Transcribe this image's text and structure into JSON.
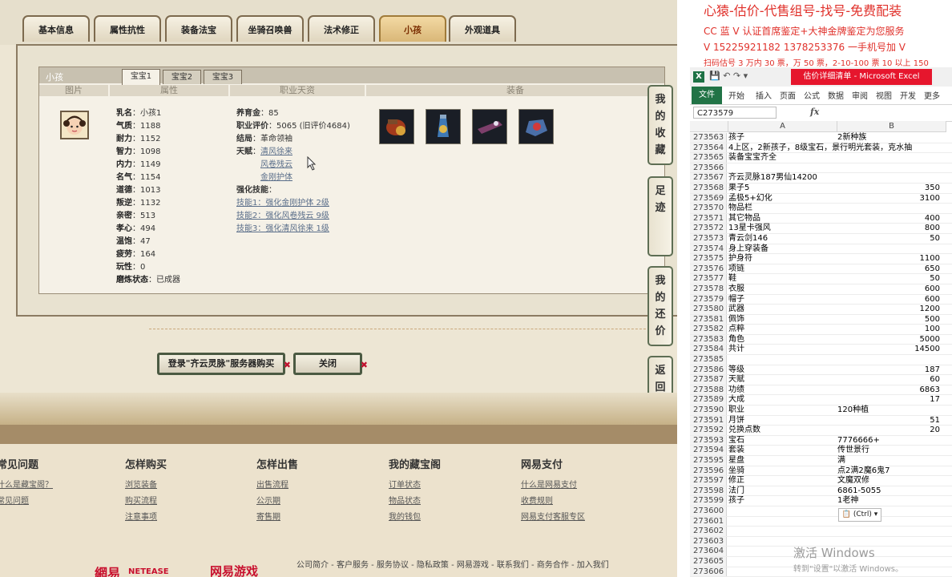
{
  "top_tabs": [
    {
      "label": "基本信息",
      "active": false
    },
    {
      "label": "属性抗性",
      "active": false
    },
    {
      "label": "装备法宝",
      "active": false
    },
    {
      "label": "坐骑召唤兽",
      "active": false
    },
    {
      "label": "法术修正",
      "active": false
    },
    {
      "label": "小孩",
      "active": true
    },
    {
      "label": "外观道具",
      "active": false
    }
  ],
  "child_panel": {
    "title": "小孩",
    "subtabs": [
      "宝宝1",
      "宝宝2",
      "宝宝3"
    ],
    "columns": [
      "图片",
      "属性",
      "职业天资",
      "装备"
    ],
    "attributes": [
      {
        "k": "乳名",
        "v": "小孩1"
      },
      {
        "k": "气质",
        "v": "1188"
      },
      {
        "k": "耐力",
        "v": "1152"
      },
      {
        "k": "智力",
        "v": "1098"
      },
      {
        "k": "内力",
        "v": "1149"
      },
      {
        "k": "名气",
        "v": "1154"
      },
      {
        "k": "道德",
        "v": "1013"
      },
      {
        "k": "叛逆",
        "v": "1132"
      },
      {
        "k": "亲密",
        "v": "513"
      },
      {
        "k": "孝心",
        "v": "494"
      },
      {
        "k": "温饱",
        "v": "47"
      },
      {
        "k": "疲劳",
        "v": "164"
      },
      {
        "k": "玩性",
        "v": "0"
      },
      {
        "k": "磨炼状态",
        "v": "已成器"
      }
    ],
    "yangyu": {
      "k": "养育金",
      "v": "85"
    },
    "zhiye": {
      "k": "职业评价",
      "v": "5065 (旧评价4684)"
    },
    "jieju": {
      "k": "结局",
      "v": "革命领袖"
    },
    "tianfu_label": "天赋",
    "tianfu": [
      "清风徐来",
      "风卷残云",
      "金刚护体"
    ],
    "skills_label": "强化技能",
    "skills": [
      "技能1：强化金刚护体 2级",
      "技能2：强化风卷残云 9级",
      "技能3：强化清风徐来 1级"
    ]
  },
  "buttons": {
    "login": "登录\"齐云灵脉\"服务器购买",
    "close": "关闭"
  },
  "side_buttons": [
    "我的收藏",
    "足迹",
    "我的还价",
    "返回顶部"
  ],
  "footer": {
    "columns": [
      {
        "title": "常见问题",
        "links": [
          "什么是藏宝阁？",
          "常见问题"
        ]
      },
      {
        "title": "怎样购买",
        "links": [
          "浏览装备",
          "购买流程",
          "注意事项"
        ]
      },
      {
        "title": "怎样出售",
        "links": [
          "出售流程",
          "公示期",
          "寄售期"
        ]
      },
      {
        "title": "我的藏宝阁",
        "links": [
          "订单状态",
          "物品状态",
          "我的钱包"
        ]
      },
      {
        "title": "网易支付",
        "links": [
          "什么是网易支付",
          "收费规则",
          "网易支付客服专区"
        ]
      }
    ],
    "bottom_links": "公司简介 - 客户服务 - 服务协议 - 隐私政策 - 网易游戏 - 联系我们 - 商务合作 - 加入我们",
    "logo_cn": "網易",
    "logo_en": "NETEASE",
    "logo_game": "网易游戏"
  },
  "ads": {
    "line1": "心猿-估价-代售组号-找号-免费配装",
    "line2": "CC 蓝 V 认证首席鉴定+大神金牌鉴定为您服务",
    "line3": "V 15225921182    1378253376 一手机号加 V",
    "line4": "扫码估号 3 万内 30 票，万 50 票，2-10-100 票 10 以上 150"
  },
  "excel": {
    "icon": "X",
    "caption": "估价详细清单 - Microsoft Excel",
    "ribbon": [
      "文件",
      "开始",
      "插入",
      "页面",
      "公式",
      "数据",
      "审阅",
      "视图",
      "开发",
      "更多"
    ],
    "namebox": "C273579",
    "fx": "fx",
    "col_a": "A",
    "col_b": "B",
    "rows": [
      {
        "n": "273563",
        "a": "孩子",
        "b": "2新种族",
        "num": false
      },
      {
        "n": "273564",
        "a": "4上区，2新孩子，8级宝石，景行明光套装，克水抽",
        "b": "",
        "num": false
      },
      {
        "n": "273565",
        "a": "装备宝宝齐全",
        "b": "",
        "num": false
      },
      {
        "n": "273566",
        "a": "",
        "b": "",
        "num": false
      },
      {
        "n": "273567",
        "a": "齐云灵脉187男仙14200",
        "b": "",
        "num": false
      },
      {
        "n": "273568",
        "a": "果子5",
        "b": "350",
        "num": true
      },
      {
        "n": "273569",
        "a": "孟极5+幻化",
        "b": "3100",
        "num": true
      },
      {
        "n": "273570",
        "a": "物品栏",
        "b": "",
        "num": false
      },
      {
        "n": "273571",
        "a": "其它物品",
        "b": "400",
        "num": true
      },
      {
        "n": "273572",
        "a": "13星卡强风",
        "b": "800",
        "num": true
      },
      {
        "n": "273573",
        "a": "青云剑146",
        "b": "50",
        "num": true
      },
      {
        "n": "273574",
        "a": "身上穿装备",
        "b": "",
        "num": false
      },
      {
        "n": "273575",
        "a": "护身符",
        "b": "1100",
        "num": true
      },
      {
        "n": "273576",
        "a": "项链",
        "b": "650",
        "num": true
      },
      {
        "n": "273577",
        "a": "鞋",
        "b": "50",
        "num": true
      },
      {
        "n": "273578",
        "a": "衣服",
        "b": "600",
        "num": true
      },
      {
        "n": "273579",
        "a": "帽子",
        "b": "600",
        "num": true
      },
      {
        "n": "273580",
        "a": "武器",
        "b": "1200",
        "num": true
      },
      {
        "n": "273581",
        "a": "佩饰",
        "b": "500",
        "num": true
      },
      {
        "n": "273582",
        "a": "点粹",
        "b": "100",
        "num": true
      },
      {
        "n": "273583",
        "a": "角色",
        "b": "5000",
        "num": true
      },
      {
        "n": "273584",
        "a": "共计",
        "b": "14500",
        "num": true
      },
      {
        "n": "273585",
        "a": "",
        "b": "",
        "num": false
      },
      {
        "n": "273586",
        "a": "等级",
        "b": "187",
        "num": true
      },
      {
        "n": "273587",
        "a": "天赋",
        "b": "60",
        "num": true
      },
      {
        "n": "273588",
        "a": "功绩",
        "b": "6863",
        "num": true
      },
      {
        "n": "273589",
        "a": "大成",
        "b": "17",
        "num": true
      },
      {
        "n": "273590",
        "a": "职业",
        "b": "120种植",
        "num": false
      },
      {
        "n": "273591",
        "a": "月饼",
        "b": "51",
        "num": true
      },
      {
        "n": "273592",
        "a": "兑换点数",
        "b": "20",
        "num": true
      },
      {
        "n": "273593",
        "a": "宝石",
        "b": "7776666+",
        "num": false
      },
      {
        "n": "273594",
        "a": "套装",
        "b": "传世景行",
        "num": false
      },
      {
        "n": "273595",
        "a": "星盘",
        "b": "满",
        "num": false
      },
      {
        "n": "273596",
        "a": "坐骑",
        "b": "点2满2魔6鬼7",
        "num": false
      },
      {
        "n": "273597",
        "a": "修正",
        "b": "文魔双修",
        "num": false
      },
      {
        "n": "273598",
        "a": "法门",
        "b": "6861-5055",
        "num": false
      },
      {
        "n": "273599",
        "a": "孩子",
        "b": "1老神",
        "num": false
      },
      {
        "n": "273600",
        "a": "",
        "b": "",
        "num": false
      },
      {
        "n": "273601",
        "a": "",
        "b": "",
        "num": false
      },
      {
        "n": "273602",
        "a": "",
        "b": "",
        "num": false
      },
      {
        "n": "273603",
        "a": "",
        "b": "",
        "num": false
      },
      {
        "n": "273604",
        "a": "",
        "b": "",
        "num": false
      },
      {
        "n": "273605",
        "a": "",
        "b": "",
        "num": false
      },
      {
        "n": "273606",
        "a": "",
        "b": "",
        "num": false
      }
    ],
    "paste_tag": "(Ctrl)"
  },
  "watermark": {
    "line1": "激活 Windows",
    "line2": "转到\"设置\"以激活 Windows。"
  }
}
